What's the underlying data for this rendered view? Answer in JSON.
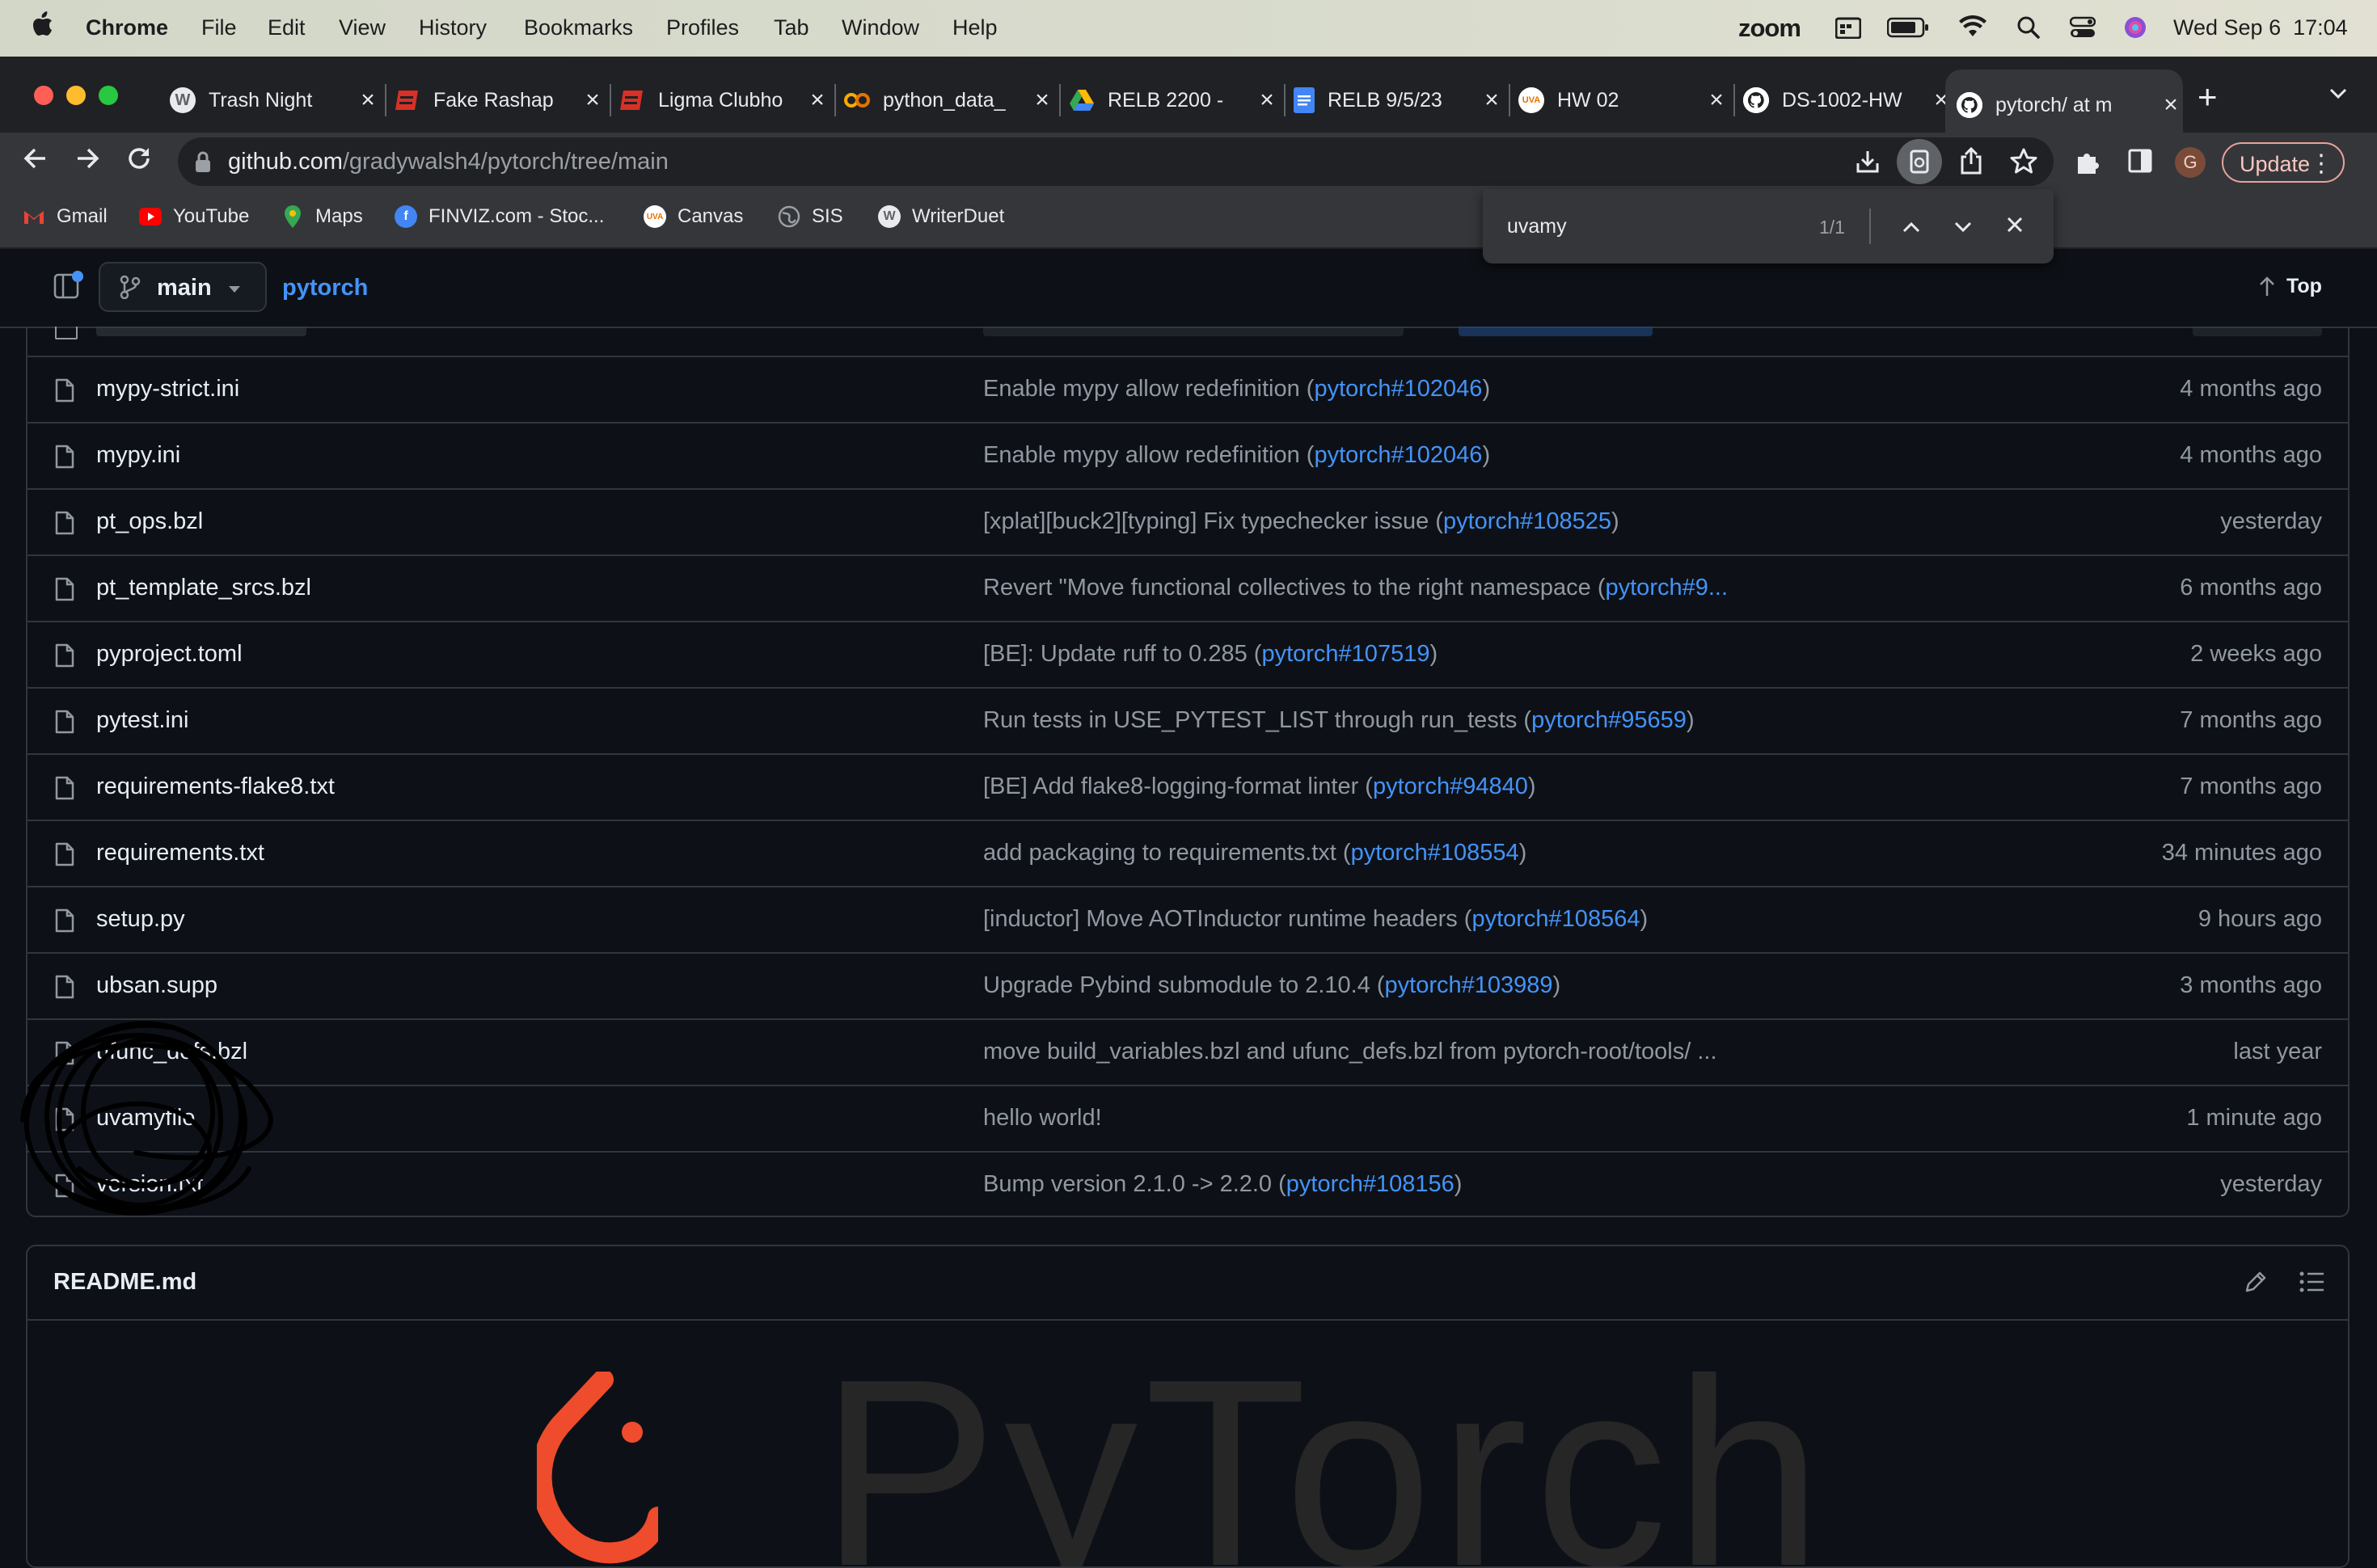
{
  "menubar": {
    "app": "Chrome",
    "menus": [
      "File",
      "Edit",
      "View",
      "History",
      "Bookmarks",
      "Profiles",
      "Tab",
      "Window",
      "Help"
    ],
    "zoom_label": "zoom",
    "datetime": "Wed Sep 6  17:04"
  },
  "tabs": [
    {
      "title": "Trash Night",
      "icon": "wordpress-icon",
      "color": "#cfd3d8"
    },
    {
      "title": "Fake Rashap",
      "icon": "sheets-red-icon",
      "color": "#d93025"
    },
    {
      "title": "Ligma Clubho",
      "icon": "sheets-red-icon",
      "color": "#d93025"
    },
    {
      "title": "python_data_",
      "icon": "colab-icon",
      "color": "#f9ab00"
    },
    {
      "title": "RELB 2200 -",
      "icon": "drive-icon",
      "color": "#34a853"
    },
    {
      "title": "RELB 9/5/23",
      "icon": "docs-icon",
      "color": "#4285f4"
    },
    {
      "title": "HW 02",
      "icon": "uva-icon",
      "color": "#e57200"
    },
    {
      "title": "DS-1002-HW",
      "icon": "github-icon",
      "color": "#ffffff"
    },
    {
      "title": "pytorch/ at m",
      "icon": "github-icon",
      "color": "#ffffff"
    }
  ],
  "toolbar": {
    "url_host": "github.com",
    "url_path": "/gradywalsh4/pytorch/tree/main",
    "update_label": "Update",
    "profile_initial": "G"
  },
  "bookmarks": [
    {
      "label": "Gmail",
      "icon": "gmail-icon",
      "color": "#ea4335"
    },
    {
      "label": "YouTube",
      "icon": "youtube-icon",
      "color": "#ff0000"
    },
    {
      "label": "Maps",
      "icon": "maps-icon",
      "color": "#34a853"
    },
    {
      "label": "FINVIZ.com - Stoc...",
      "icon": "finviz-icon",
      "color": "#4285f4"
    },
    {
      "label": "Canvas",
      "icon": "uva-icon",
      "color": "#e57200"
    },
    {
      "label": "SIS",
      "icon": "globe-icon",
      "color": "#9aa0a6"
    },
    {
      "label": "WriterDuet",
      "icon": "wordpress-icon",
      "color": "#cfd3d8"
    }
  ],
  "find": {
    "query": "uvamy",
    "count": "1/1"
  },
  "repo_header": {
    "branch": "main",
    "repo": "pytorch",
    "top_label": "Top"
  },
  "files": [
    {
      "name": "mypy-strict.ini",
      "msg": "Enable mypy allow redefinition (",
      "link": "pytorch#102046",
      "tail": ")",
      "age": "4 months ago"
    },
    {
      "name": "mypy.ini",
      "msg": "Enable mypy allow redefinition (",
      "link": "pytorch#102046",
      "tail": ")",
      "age": "4 months ago"
    },
    {
      "name": "pt_ops.bzl",
      "msg": "[xplat][buck2][typing] Fix typechecker issue (",
      "link": "pytorch#108525",
      "tail": ")",
      "age": "yesterday"
    },
    {
      "name": "pt_template_srcs.bzl",
      "msg": "Revert \"Move functional collectives to the right namespace (",
      "link": "pytorch#9...",
      "tail": "",
      "age": "6 months ago"
    },
    {
      "name": "pyproject.toml",
      "msg": "[BE]: Update ruff to 0.285 (",
      "link": "pytorch#107519",
      "tail": ")",
      "age": "2 weeks ago"
    },
    {
      "name": "pytest.ini",
      "msg": "Run tests in USE_PYTEST_LIST through run_tests (",
      "link": "pytorch#95659",
      "tail": ")",
      "age": "7 months ago"
    },
    {
      "name": "requirements-flake8.txt",
      "msg": "[BE] Add flake8-logging-format linter (",
      "link": "pytorch#94840",
      "tail": ")",
      "age": "7 months ago"
    },
    {
      "name": "requirements.txt",
      "msg": "add packaging to requirements.txt (",
      "link": "pytorch#108554",
      "tail": ")",
      "age": "34 minutes ago"
    },
    {
      "name": "setup.py",
      "msg": "[inductor] Move AOTInductor runtime headers (",
      "link": "pytorch#108564",
      "tail": ")",
      "age": "9 hours ago"
    },
    {
      "name": "ubsan.supp",
      "msg": "Upgrade Pybind submodule to 2.10.4 (",
      "link": "pytorch#103989",
      "tail": ")",
      "age": "3 months ago"
    },
    {
      "name": "ufunc_defs.bzl",
      "msg": "move build_variables.bzl and ufunc_defs.bzl from pytorch-root/tools/ ...",
      "link": "",
      "tail": "",
      "age": "last year"
    },
    {
      "name": "uvamyfile",
      "msg": "hello world!",
      "link": "",
      "tail": "",
      "age": "1 minute ago"
    },
    {
      "name": "version.txt",
      "msg": "Bump version 2.1.0 -> 2.2.0 (",
      "link": "pytorch#108156",
      "tail": ")",
      "age": "yesterday"
    }
  ],
  "readme": {
    "title": "README.md",
    "logo_text": "PyTorch",
    "logo_color": "#ee4c2c"
  }
}
